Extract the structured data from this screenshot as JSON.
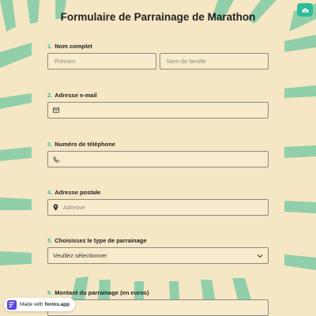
{
  "form": {
    "title": "Formulaire de Parrainage de Marathon",
    "questions": [
      {
        "number": "1.",
        "label": "Nom complet",
        "placeholders": [
          "Prénom",
          "Nom de famille"
        ]
      },
      {
        "number": "2.",
        "label": "Adresse e-mail",
        "placeholder": ""
      },
      {
        "number": "3.",
        "label": "Numéro de téléphone",
        "placeholder": ""
      },
      {
        "number": "4.",
        "label": "Adresse postale",
        "placeholder": "Adresse"
      },
      {
        "number": "5.",
        "label": "Choisissez le type de parrainage",
        "selected": "Veuillez sélectionner"
      },
      {
        "number": "6.",
        "label": "Montant du parrainage (en euros)"
      }
    ]
  },
  "badge": {
    "prefix": "Made with",
    "brand": "forms.app"
  },
  "icons": {
    "corner": "cloud-save-icon",
    "email": "envelope-icon",
    "phone": "phone-icon",
    "address": "location-pin-icon",
    "select": "chevron-down-icon",
    "brand": "forms-app-logo-icon"
  },
  "colors": {
    "background": "#f5e6c4",
    "accent": "#2ebd98",
    "field_bg": "#f8ebcb",
    "field_border": "#8a8a8a"
  }
}
